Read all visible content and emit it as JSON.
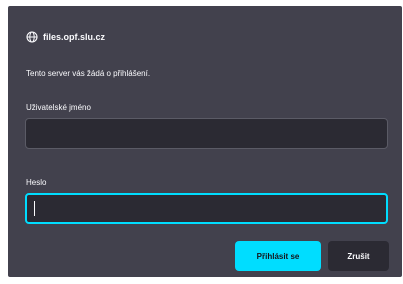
{
  "dialog": {
    "origin": "files.opf.slu.cz",
    "origin_icon": "globe-icon",
    "message": "Tento server vás žádá o přihlášení.",
    "username": {
      "label": "Uživatelské jméno",
      "value": ""
    },
    "password": {
      "label": "Heslo",
      "value": "",
      "focused": true
    },
    "buttons": {
      "login": "Přihlásit se",
      "cancel": "Zrušit"
    }
  },
  "colors": {
    "dialog_background": "#42414d",
    "input_background": "#2b2a33",
    "accent": "#00ddff",
    "text": "#fbfbfe"
  }
}
